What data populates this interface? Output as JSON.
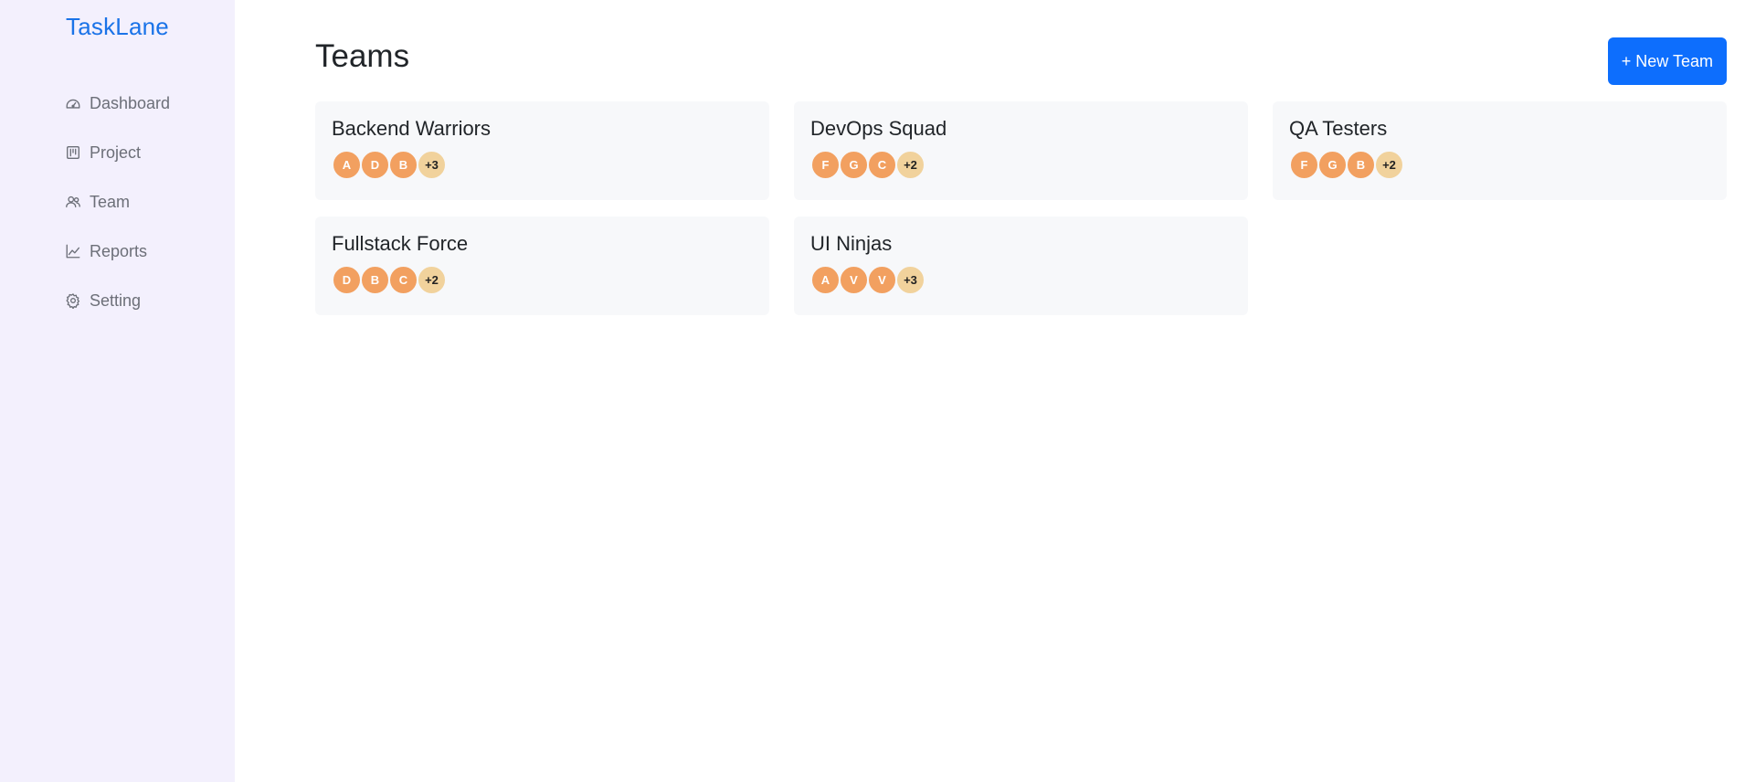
{
  "app": {
    "brand": "TaskLane"
  },
  "sidebar": {
    "items": [
      {
        "label": "Dashboard",
        "icon": "dashboard-icon"
      },
      {
        "label": "Project",
        "icon": "project-icon"
      },
      {
        "label": "Team",
        "icon": "team-icon"
      },
      {
        "label": "Reports",
        "icon": "reports-icon"
      },
      {
        "label": "Setting",
        "icon": "gear-icon"
      }
    ]
  },
  "main": {
    "title": "Teams",
    "new_team_label": "+ New Team",
    "teams": [
      {
        "name": "Backend Warriors",
        "members": [
          "A",
          "D",
          "B"
        ],
        "more": "+3"
      },
      {
        "name": "DevOps Squad",
        "members": [
          "F",
          "G",
          "C"
        ],
        "more": "+2"
      },
      {
        "name": "QA Testers",
        "members": [
          "F",
          "G",
          "B"
        ],
        "more": "+2"
      },
      {
        "name": "Fullstack Force",
        "members": [
          "D",
          "B",
          "C"
        ],
        "more": "+2"
      },
      {
        "name": "UI Ninjas",
        "members": [
          "A",
          "V",
          "V"
        ],
        "more": "+3"
      }
    ]
  },
  "colors": {
    "sidebar_bg": "#f3f0fd",
    "brand": "#1a73e8",
    "primary_button": "#0d6efd",
    "card_bg": "#f7f8fa",
    "avatar": "#f2a060",
    "avatar_more": "#f1d29c"
  }
}
